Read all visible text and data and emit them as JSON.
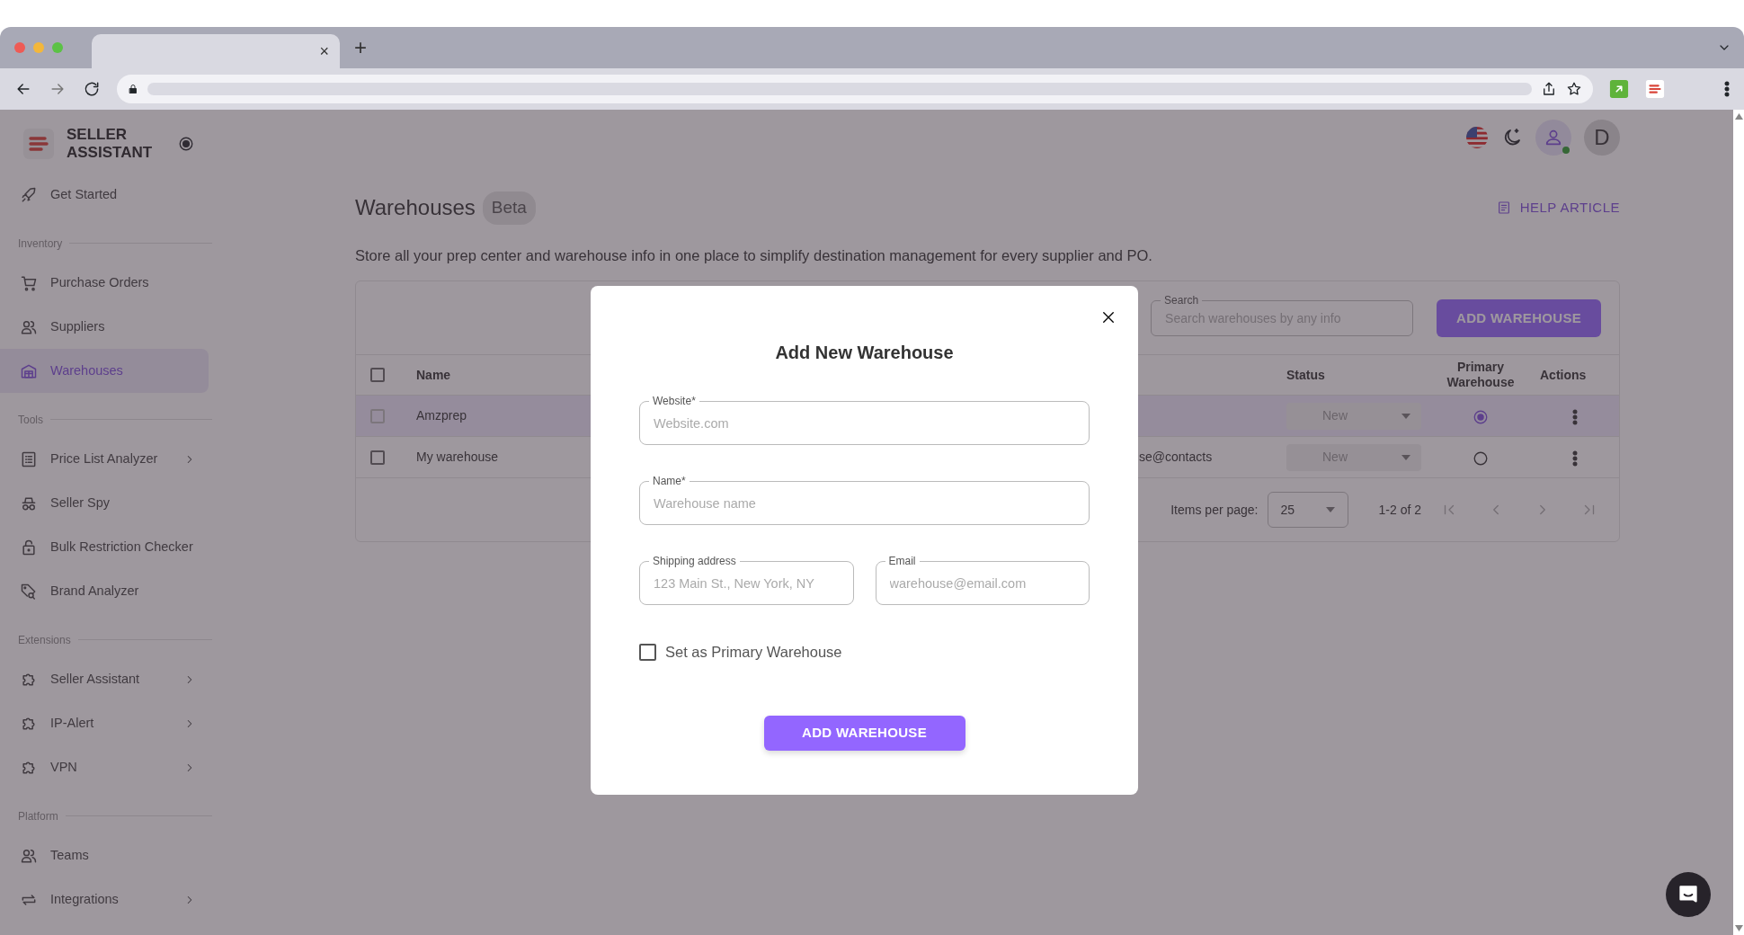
{
  "browser": {
    "tab_close": "×",
    "new_tab": "+"
  },
  "sidebar": {
    "brand": "SELLER ASSISTANT",
    "items": [
      {
        "kind": "link",
        "label": "Get Started",
        "selected": false,
        "has_submenu": false
      },
      {
        "kind": "section",
        "label": "Inventory"
      },
      {
        "kind": "link",
        "label": "Purchase Orders",
        "selected": false,
        "has_submenu": false
      },
      {
        "kind": "link",
        "label": "Suppliers",
        "selected": false,
        "has_submenu": false
      },
      {
        "kind": "link",
        "label": "Warehouses",
        "selected": true,
        "has_submenu": false
      },
      {
        "kind": "section",
        "label": "Tools"
      },
      {
        "kind": "link",
        "label": "Price List Analyzer",
        "selected": false,
        "has_submenu": true
      },
      {
        "kind": "link",
        "label": "Seller Spy",
        "selected": false,
        "has_submenu": false
      },
      {
        "kind": "link",
        "label": "Bulk Restriction Checker",
        "selected": false,
        "has_submenu": false
      },
      {
        "kind": "link",
        "label": "Brand Analyzer",
        "selected": false,
        "has_submenu": false
      },
      {
        "kind": "section",
        "label": "Extensions"
      },
      {
        "kind": "link",
        "label": "Seller Assistant",
        "selected": false,
        "has_submenu": true
      },
      {
        "kind": "link",
        "label": "IP-Alert",
        "selected": false,
        "has_submenu": true
      },
      {
        "kind": "link",
        "label": "VPN",
        "selected": false,
        "has_submenu": true
      },
      {
        "kind": "section",
        "label": "Platform"
      },
      {
        "kind": "link",
        "label": "Teams",
        "selected": false,
        "has_submenu": false
      },
      {
        "kind": "link",
        "label": "Integrations",
        "selected": false,
        "has_submenu": true
      }
    ]
  },
  "header": {
    "avatar": "D",
    "online": true
  },
  "page": {
    "title": "Warehouses",
    "badge": "Beta",
    "help": "HELP ARTICLE",
    "description": "Store all your prep center and warehouse info in one place to simplify destination management for every supplier and PO."
  },
  "table": {
    "search": {
      "label": "Search",
      "placeholder": "Search warehouses by any info"
    },
    "add_button": "ADD WAREHOUSE",
    "all_checked": false,
    "columns": [
      "Name",
      "Status",
      "Primary Warehouse",
      "Actions"
    ],
    "rows": [
      {
        "selected": true,
        "checked": false,
        "name": "Amzprep",
        "status": "New",
        "primary": true
      },
      {
        "selected": false,
        "checked": false,
        "name": "My warehouse",
        "column_3": "se@contacts",
        "status": "New",
        "primary": false
      }
    ],
    "items_per_page_label": "Items per page:",
    "items_per_page": "25",
    "range": "1-2 of 2"
  },
  "modal": {
    "title": "Add New Warehouse",
    "fields": [
      {
        "label": "Website*",
        "placeholder": "Website.com",
        "half": false
      },
      {
        "label": "Name*",
        "placeholder": "Warehouse name",
        "half": false
      },
      {
        "label": "Shipping address",
        "placeholder": "123 Main St., New York, NY",
        "half": true
      },
      {
        "label": "Email",
        "placeholder": "warehouse@email.com",
        "half": true
      }
    ],
    "checkbox": {
      "label": "Set as Primary Warehouse",
      "checked": false
    },
    "submit": "ADD WAREHOUSE"
  }
}
